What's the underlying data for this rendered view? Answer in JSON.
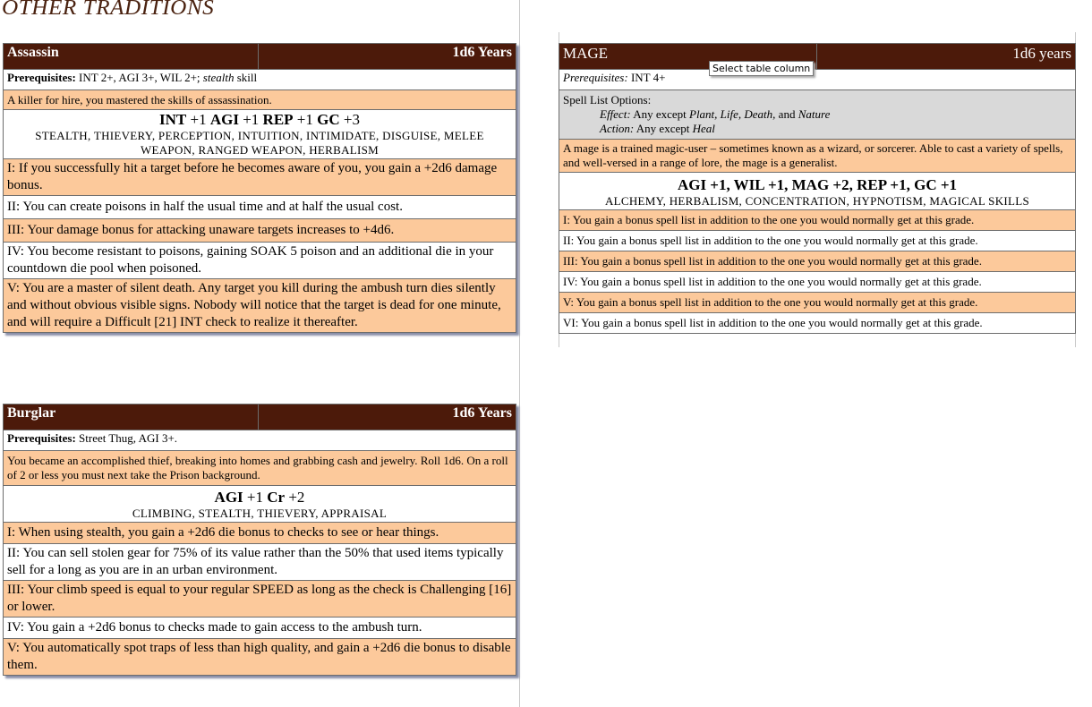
{
  "heading": "Other Traditions",
  "tooltip": "Select table column",
  "assassin": {
    "name": "Assassin",
    "years": "1d6 Years",
    "prereq_label": "Prerequisites:",
    "prereq_text": " INT 2+, AGI 3+, WIL 2+; ",
    "prereq_italic": "stealth",
    "prereq_tail": " skill",
    "description": "A killer for hire, you mastered the skills of assassination.",
    "stat1": "INT",
    "stat1_val": " +1  ",
    "stat2": "AGI",
    "stat2_val": " +1 ",
    "stat3": "REP",
    "stat3_val": " +1 ",
    "stat4": "GC",
    "stat4_val": " +3",
    "skills": "STEALTH, THIEVERY, PERCEPTION, INTUITION, INTIMIDATE, DISGUISE, MELEE WEAPON, RANGED WEAPON, HERBALISM",
    "grades": [
      "I: If you successfully hit a target before he becomes aware of you, you gain a +2d6 damage bonus.",
      "II:  You can create poisons in half the usual time and at half the usual cost.",
      "III: Your damage bonus for attacking unaware targets increases to +4d6.",
      "IV: You become resistant to poisons, gaining SOAK 5 poison and an additional die in your countdown die pool when poisoned.",
      "V: You are a master of silent death.  Any target you kill during the ambush turn dies silently and without obvious visible signs.  Nobody will notice that the target is dead for one minute, and will require a Difficult [21] INT check to realize it thereafter."
    ]
  },
  "burglar": {
    "name": "Burglar",
    "years": "1d6 Years",
    "prereq_label": "Prerequisites:",
    "prereq_text": " Street Thug, AGI 3+.",
    "description": "You became an accomplished thief, breaking into homes and grabbing cash and jewelry. Roll 1d6. On a roll of 2 or less you must next take the Prison background.",
    "stat1": "AGI",
    "stat1_val": " +1 ",
    "stat2": "Cr",
    "stat2_val": " +2",
    "skills": "CLIMBING, STEALTH, THIEVERY, APPRAISAL",
    "grades": [
      "I: When using stealth, you gain a +2d6 die bonus to checks to see or hear things.",
      "II: You can sell stolen gear for 75% of its value rather than the 50% that used items typically sell for a long as you are in an urban environment.",
      "III: Your climb speed is equal to your regular SPEED as long as the check is Challenging [16] or lower.",
      "IV: You gain a +2d6 bonus to checks made to gain access to the ambush turn.",
      "V: You automatically spot traps of less than high quality, and gain a +2d6 die bonus to disable them."
    ]
  },
  "mage": {
    "name": "MAGE",
    "years": "1d6 years",
    "prereq_label": "Prerequisites:",
    "prereq_text": "  INT 4+",
    "spell_options": "Spell List Options:",
    "effect_label": "Effect:",
    "effect_text": " Any except ",
    "effect_excl": "Plant, Life, Death,",
    "effect_and": " and ",
    "effect_last": "Nature",
    "action_label": "Action:",
    "action_text": " Any except ",
    "action_excl": "Heal",
    "description": "A mage is a trained magic-user – sometimes known as a wizard, or sorcerer. Able to cast a variety of spells, and well-versed in a range of lore, the mage is a generalist.",
    "stats": "AGI +1, WIL +1, MAG +2, REP +1, GC +1",
    "skills": "ALCHEMY, HERBALISM, CONCENTRATION, HYPNOTISM, MAGICAL SKILLS",
    "grades": [
      "I: You gain a bonus spell list in addition to the one you would normally get at this grade.",
      "II: You gain a bonus spell list in addition to the one you would normally get at this grade.",
      "III: You gain a bonus spell list in addition to the one you would normally get at this grade.",
      "IV: You gain a bonus spell list in addition to the one you would normally get at this grade.",
      "V: You gain a bonus spell list in addition to the one you would normally get at this grade.",
      "VI: You gain a bonus spell list in addition to the one you would normally get at this grade."
    ]
  }
}
